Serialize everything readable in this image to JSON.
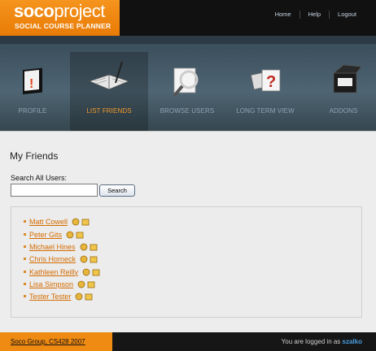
{
  "header": {
    "logo_bold": "soco",
    "logo_light": "project",
    "tagline": "SOCIAL COURSE PLANNER",
    "links": [
      "Home",
      "Help",
      "Logout"
    ]
  },
  "nav": {
    "items": [
      {
        "label": "PROFILE",
        "icon": "profile-book-icon"
      },
      {
        "label": "LIST FRIENDS",
        "icon": "notebook-pen-icon",
        "active": true
      },
      {
        "label": "BROWSE USERS",
        "icon": "magnifier-icon"
      },
      {
        "label": "LONG TERM VIEW",
        "icon": "cards-question-icon"
      },
      {
        "label": "ADDONS",
        "icon": "addons-box-icon"
      }
    ],
    "active_color": "#f39a2a"
  },
  "main": {
    "title": "My Friends",
    "search_label": "Search All Users:",
    "search_value": "",
    "search_button": "Search",
    "friends": [
      "Matt Cowell",
      "Peter Gits",
      "Michael Hines",
      "Chris Horneck",
      "Kathleen Reilly",
      "Lisa Simpson",
      "Tester Tester"
    ]
  },
  "footer": {
    "copyright": "Soco Group, CS428 2007",
    "status_prefix": "You are logged in as ",
    "username": "szalko"
  }
}
